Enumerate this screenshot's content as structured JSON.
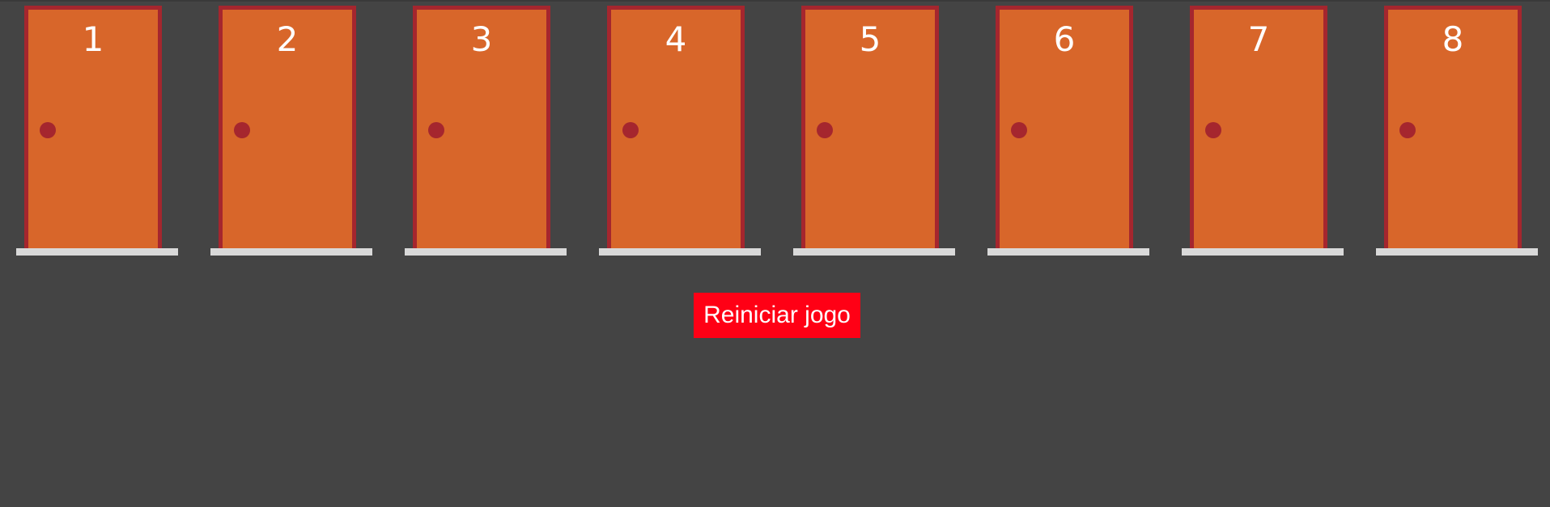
{
  "game": {
    "doors": [
      {
        "number": "1"
      },
      {
        "number": "2"
      },
      {
        "number": "3"
      },
      {
        "number": "4"
      },
      {
        "number": "5"
      },
      {
        "number": "6"
      },
      {
        "number": "7"
      },
      {
        "number": "8"
      }
    ],
    "restart_label": "Reiniciar jogo"
  },
  "colors": {
    "background": "#444444",
    "door": "#d8662a",
    "door_frame": "#a5262e",
    "threshold": "#d9d9d9",
    "button": "#ff0015",
    "text": "#ffffff"
  }
}
